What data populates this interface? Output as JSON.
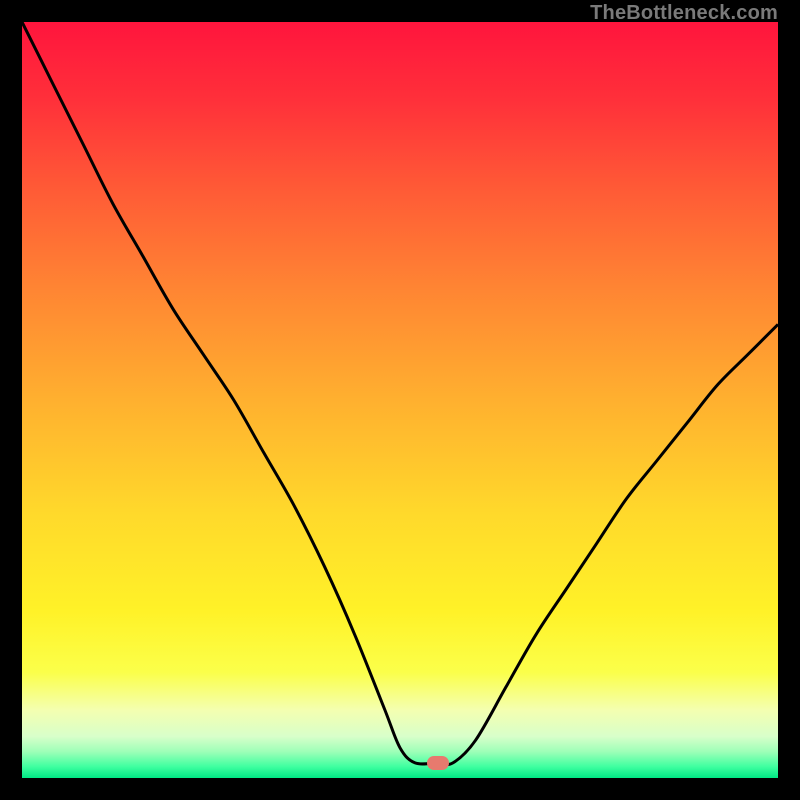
{
  "watermark": "TheBottleneck.com",
  "colors": {
    "curve": "#000000",
    "marker": "#e77a6e",
    "frame": "#000000"
  },
  "chart_data": {
    "type": "line",
    "title": "",
    "xlabel": "",
    "ylabel": "",
    "xlim": [
      0,
      100
    ],
    "ylim": [
      0,
      100
    ],
    "grid": false,
    "legend": false,
    "series": [
      {
        "name": "bottleneck-curve",
        "x": [
          0,
          4,
          8,
          12,
          16,
          20,
          24,
          28,
          32,
          36,
          40,
          44,
          48,
          50,
          52,
          55,
          57,
          60,
          64,
          68,
          72,
          76,
          80,
          84,
          88,
          92,
          96,
          100
        ],
        "y": [
          100,
          92,
          84,
          76,
          69,
          62,
          56,
          50,
          43,
          36,
          28,
          19,
          9,
          4,
          2,
          2,
          2,
          5,
          12,
          19,
          25,
          31,
          37,
          42,
          47,
          52,
          56,
          60
        ]
      }
    ],
    "flat_segment": {
      "x_start": 50,
      "x_end": 57,
      "y": 2
    },
    "marker": {
      "x": 55,
      "y": 2
    },
    "annotations": []
  }
}
